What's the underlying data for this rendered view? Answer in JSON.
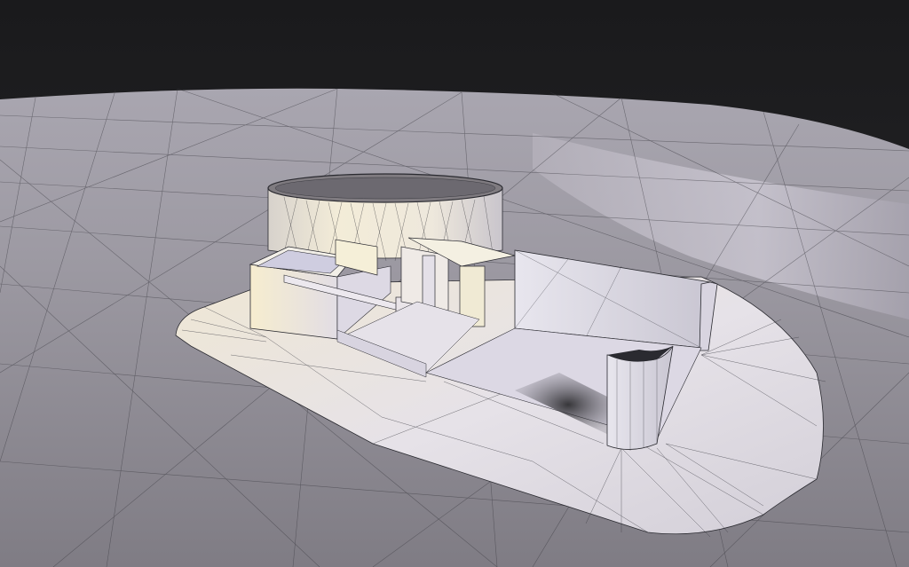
{
  "scene": {
    "kind": "3d-wireframe-model",
    "shading": "flat-with-wireframe-overlay",
    "background_color": "#1c1c1e",
    "ground_color": "#8c8a92",
    "model_color": "#e9e4de",
    "wire_color": "#2a2a30",
    "light_tint": "#f4e8c8"
  }
}
